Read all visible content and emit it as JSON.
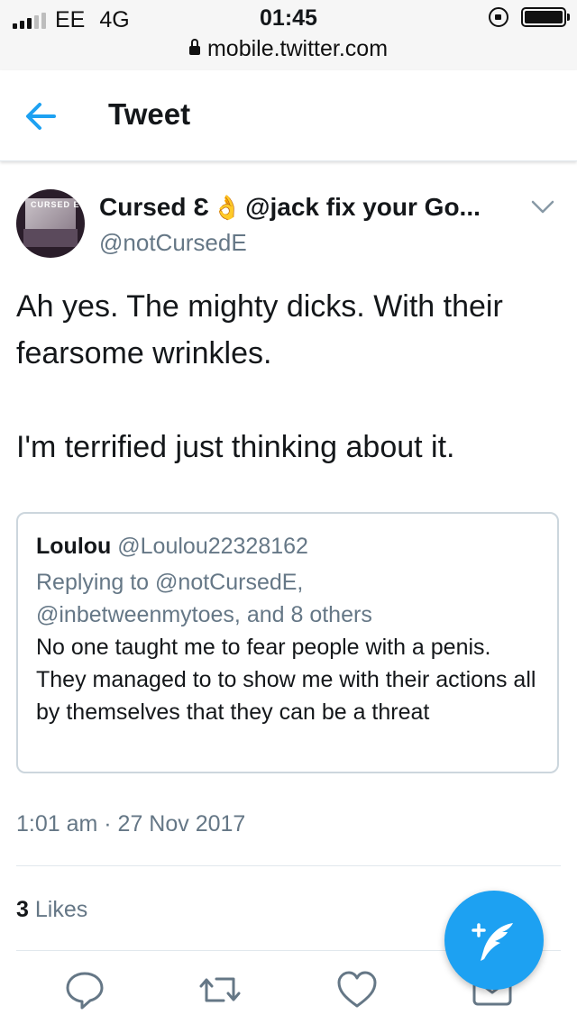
{
  "status_bar": {
    "carrier": "EE",
    "network": "4G",
    "time": "01:45",
    "url": "mobile.twitter.com"
  },
  "header": {
    "title": "Tweet",
    "back_icon": "arrow-left-icon"
  },
  "tweet": {
    "author_name": "Cursed Ɛ",
    "author_emoji": "👌",
    "author_name_suffix": "@jack fix your Go...",
    "author_handle": "@notCursedE",
    "avatar_text": "CURSED E",
    "text": "Ah yes. The mighty dicks. With their fearsome wrinkles.\n\nI'm terrified just thinking about it.",
    "timestamp": "1:01 am · 27 Nov 2017",
    "likes_count": "3",
    "likes_label": "Likes"
  },
  "quoted_tweet": {
    "name": "Loulou",
    "handle": "@Loulou22328162",
    "replying_prefix": "Replying to",
    "replying_to": "@notCursedE,",
    "replying_line2": "@inbetweenmytoes, and 8 others",
    "text": "No one taught me to fear people with a penis. They managed to to show me with their actions all by themselves that they can be a threat"
  },
  "actions": {
    "reply_icon": "reply-icon",
    "retweet_icon": "retweet-icon",
    "like_icon": "heart-icon",
    "message_icon": "envelope-icon",
    "compose_icon": "compose-tweet-icon"
  },
  "colors": {
    "accent": "#1da1f2",
    "secondary_text": "#657786",
    "primary_text": "#14171a",
    "border": "#ccd6dd"
  }
}
